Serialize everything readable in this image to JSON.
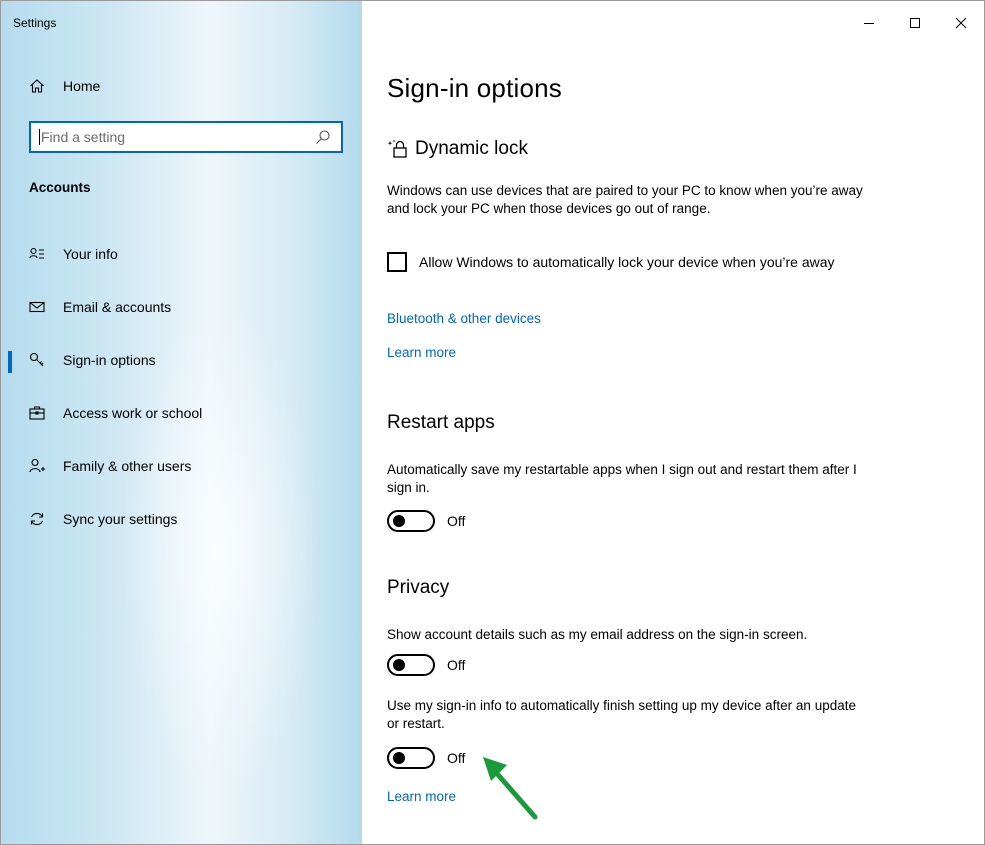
{
  "window": {
    "app_title": "Settings",
    "controls": {
      "minimize": "minimize-icon",
      "maximize": "maximize-icon",
      "close": "close-icon"
    }
  },
  "sidebar": {
    "home_label": "Home",
    "search_placeholder": "Find a setting",
    "section_heading": "Accounts",
    "items": [
      {
        "label": "Your info",
        "icon": "person-card-icon",
        "active": false
      },
      {
        "label": "Email & accounts",
        "icon": "mail-icon",
        "active": false
      },
      {
        "label": "Sign-in options",
        "icon": "key-icon",
        "active": true
      },
      {
        "label": "Access work or school",
        "icon": "briefcase-icon",
        "active": false
      },
      {
        "label": "Family & other users",
        "icon": "person-add-icon",
        "active": false
      },
      {
        "label": "Sync your settings",
        "icon": "sync-icon",
        "active": false
      }
    ]
  },
  "main": {
    "page_title": "Sign-in options",
    "dynamic_lock": {
      "title": "Dynamic lock",
      "description": "Windows can use devices that are paired to your PC to know when you’re away and lock your PC when those devices go out of range.",
      "checkbox_label": "Allow Windows to automatically lock your device when you’re away",
      "checkbox_checked": false,
      "link_bluetooth": "Bluetooth & other devices",
      "link_learn_more": "Learn more"
    },
    "restart_apps": {
      "title": "Restart apps",
      "description": "Automatically save my restartable apps when I sign out and restart them after I sign in.",
      "toggle_state": "Off"
    },
    "privacy": {
      "title": "Privacy",
      "show_details_description": "Show account details such as my email address on the sign-in screen.",
      "show_details_toggle": "Off",
      "sign_in_info_description": "Use my sign-in info to automatically finish setting up my device after an update or restart.",
      "sign_in_info_toggle": "Off",
      "link_learn_more": "Learn more"
    }
  },
  "colors": {
    "accent": "#0067c0",
    "annotation_arrow": "#1a9a3a",
    "sidebar_bg": "#c7e4f2"
  }
}
